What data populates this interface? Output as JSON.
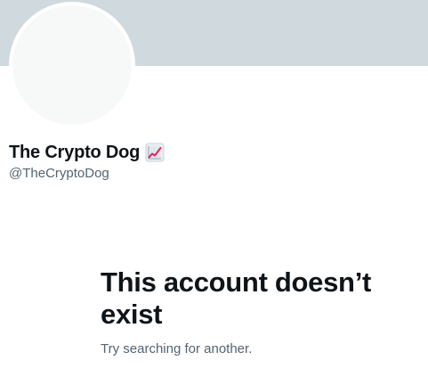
{
  "profile": {
    "display_name": "The Crypto Dog",
    "name_emoji_icon": "chart-increasing-icon",
    "handle": "@TheCryptoDog",
    "colors": {
      "banner": "#cfd9de",
      "avatar": "#f7f9f9",
      "primary_text": "#0f1419",
      "secondary_text": "#536471"
    }
  },
  "empty_state": {
    "title": "This account doesn’t exist",
    "subtitle": "Try searching for another."
  }
}
